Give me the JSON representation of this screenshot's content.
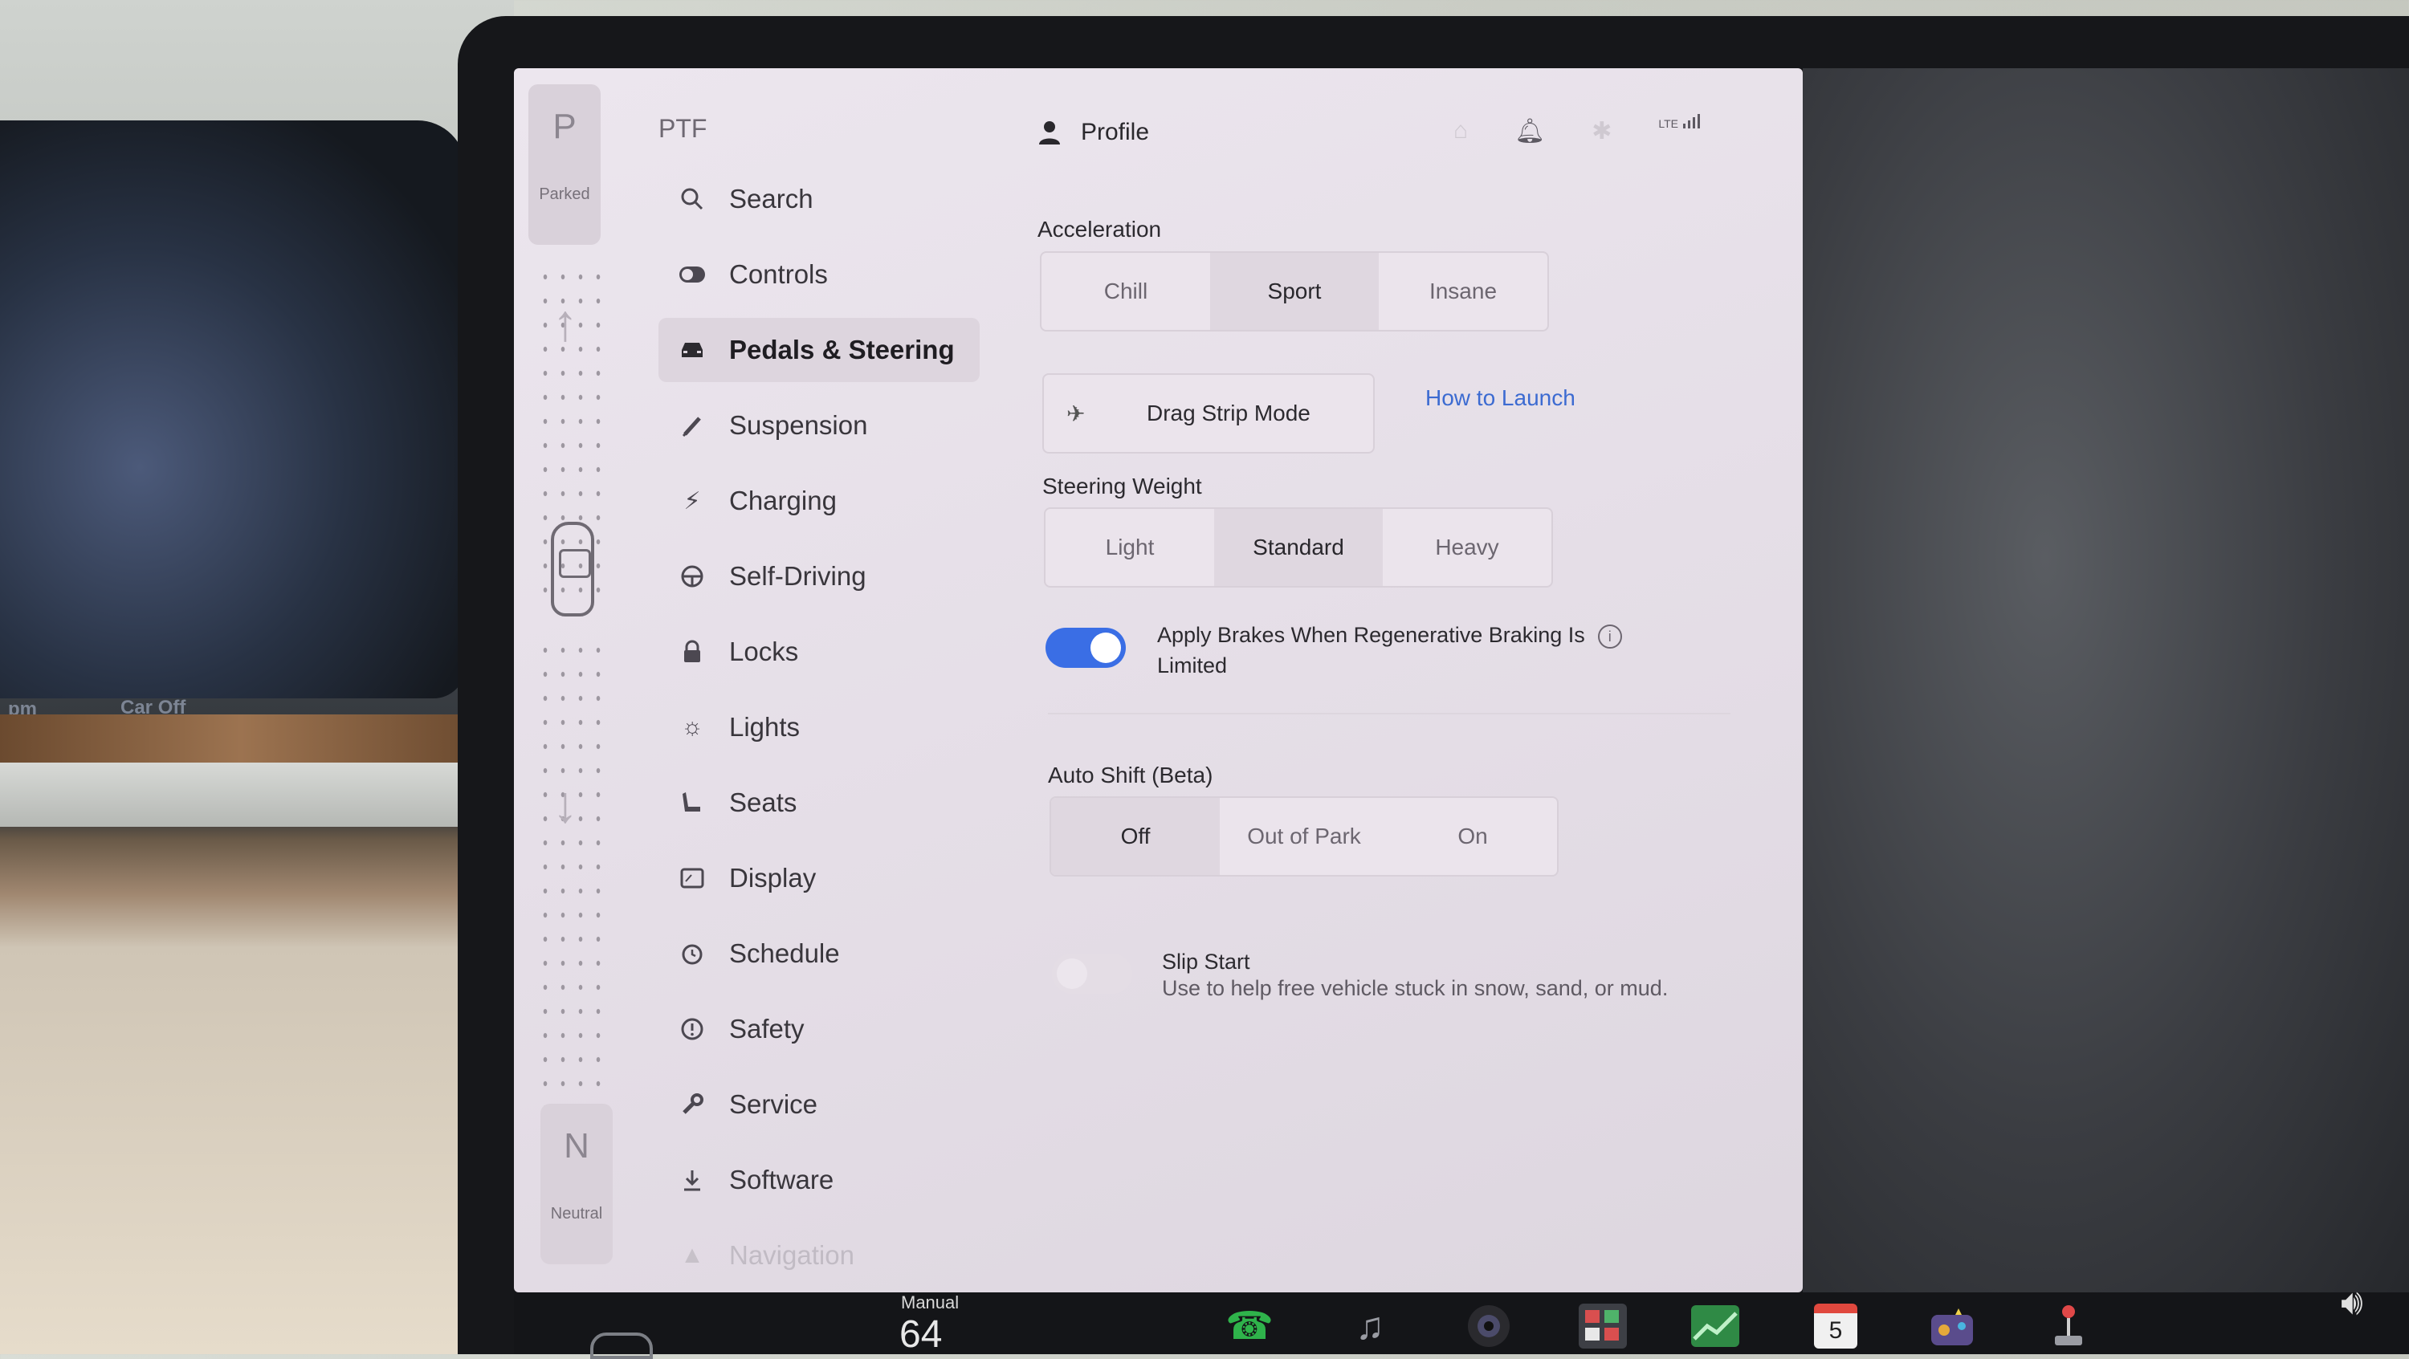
{
  "cluster": {
    "time_suffix": "pm",
    "status": "Car Off"
  },
  "gear": {
    "top_letter": "P",
    "top_label": "Parked",
    "bottom_letter": "N",
    "bottom_label": "Neutral"
  },
  "app": {
    "title": "PTF"
  },
  "sidebar": {
    "items": [
      {
        "label": "Search",
        "icon": "search-icon"
      },
      {
        "label": "Controls",
        "icon": "toggle-icon"
      },
      {
        "label": "Pedals & Steering",
        "icon": "car-icon",
        "active": true
      },
      {
        "label": "Suspension",
        "icon": "suspension-icon"
      },
      {
        "label": "Charging",
        "icon": "bolt-icon"
      },
      {
        "label": "Self-Driving",
        "icon": "steering-wheel-icon"
      },
      {
        "label": "Locks",
        "icon": "lock-icon"
      },
      {
        "label": "Lights",
        "icon": "sun-icon"
      },
      {
        "label": "Seats",
        "icon": "seat-icon"
      },
      {
        "label": "Display",
        "icon": "display-icon"
      },
      {
        "label": "Schedule",
        "icon": "alarm-clock-icon"
      },
      {
        "label": "Safety",
        "icon": "alert-circle-icon"
      },
      {
        "label": "Service",
        "icon": "wrench-icon"
      },
      {
        "label": "Software",
        "icon": "download-icon"
      },
      {
        "label": "Navigation",
        "icon": "navigation-arrow-icon"
      }
    ]
  },
  "header": {
    "profile_label": "Profile",
    "status_icons": [
      "garage-icon",
      "bell-icon",
      "bluetooth-icon",
      "lte-signal-icon"
    ],
    "lte": "LTE"
  },
  "acceleration": {
    "label": "Acceleration",
    "options": [
      "Chill",
      "Sport",
      "Insane"
    ],
    "selected": "Sport"
  },
  "drag_strip": {
    "button_label": "Drag Strip Mode",
    "link_label": "How to Launch"
  },
  "steering_weight": {
    "label": "Steering Weight",
    "options": [
      "Light",
      "Standard",
      "Heavy"
    ],
    "selected": "Standard"
  },
  "regen_brakes": {
    "label_line1": "Apply Brakes When Regenerative Braking Is",
    "label_line2": "Limited",
    "enabled": true
  },
  "auto_shift": {
    "label": "Auto Shift (Beta)",
    "options": [
      "Off",
      "Out of Park",
      "On"
    ],
    "selected": "Off"
  },
  "slip_start": {
    "label": "Slip Start",
    "description": "Use to help free vehicle stuck in snow, sand, or mud.",
    "enabled": false
  },
  "taskbar": {
    "climate_mode": "Manual",
    "temperature": "64",
    "calendar_day": "5",
    "apps": [
      "phone-icon",
      "music-icon",
      "camera-icon",
      "toybox-icon",
      "stocks-icon",
      "calendar-icon",
      "arcade-icon",
      "joystick-icon"
    ]
  },
  "colors": {
    "accent": "#3a6ee5",
    "link": "#3c6bd1",
    "screen_bg": "#e9e2ea"
  }
}
